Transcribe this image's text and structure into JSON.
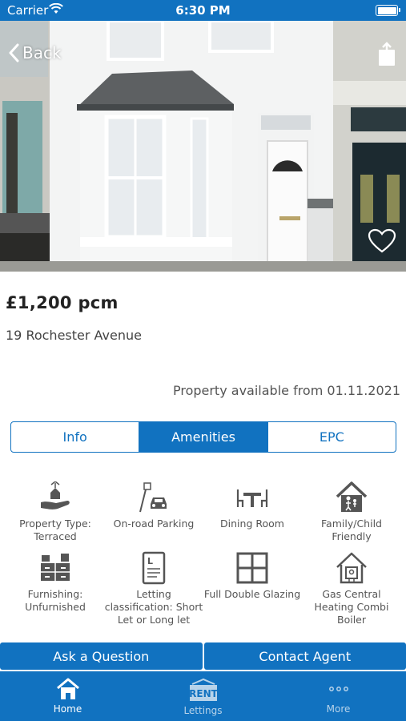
{
  "status_bar": {
    "carrier": "Carrier",
    "time": "6:30 PM"
  },
  "nav": {
    "back_label": "Back"
  },
  "listing": {
    "price": "£1,200 pcm",
    "address": "19 Rochester Avenue",
    "availability": "Property available from 01.11.2021"
  },
  "tabs": [
    {
      "label": "Info",
      "active": false
    },
    {
      "label": "Amenities",
      "active": true
    },
    {
      "label": "EPC",
      "active": false
    }
  ],
  "amenities": [
    {
      "label": "Property Type: Terraced",
      "icon": "hand-house-icon"
    },
    {
      "label": "On-road Parking",
      "icon": "car-parking-icon"
    },
    {
      "label": "Dining Room",
      "icon": "dining-table-icon"
    },
    {
      "label": "Family/Child Friendly",
      "icon": "family-house-icon"
    },
    {
      "label": "Furnishing: Unfurnished",
      "icon": "furniture-icon"
    },
    {
      "label": "Letting classification: Short Let or Long let",
      "icon": "document-icon"
    },
    {
      "label": "Full Double Glazing",
      "icon": "window-icon"
    },
    {
      "label": "Gas Central Heating Combi Boiler",
      "icon": "boiler-icon"
    }
  ],
  "actions": {
    "ask": "Ask a Question",
    "contact": "Contact Agent"
  },
  "tabbar": [
    {
      "label": "Home",
      "icon": "home-icon"
    },
    {
      "label": "Lettings",
      "icon": "rent-sign-icon",
      "badge": "RENT"
    },
    {
      "label": "More",
      "icon": "more-dots-icon"
    }
  ],
  "colors": {
    "primary": "#1172c0",
    "text": "#222222",
    "muted": "#555555"
  }
}
